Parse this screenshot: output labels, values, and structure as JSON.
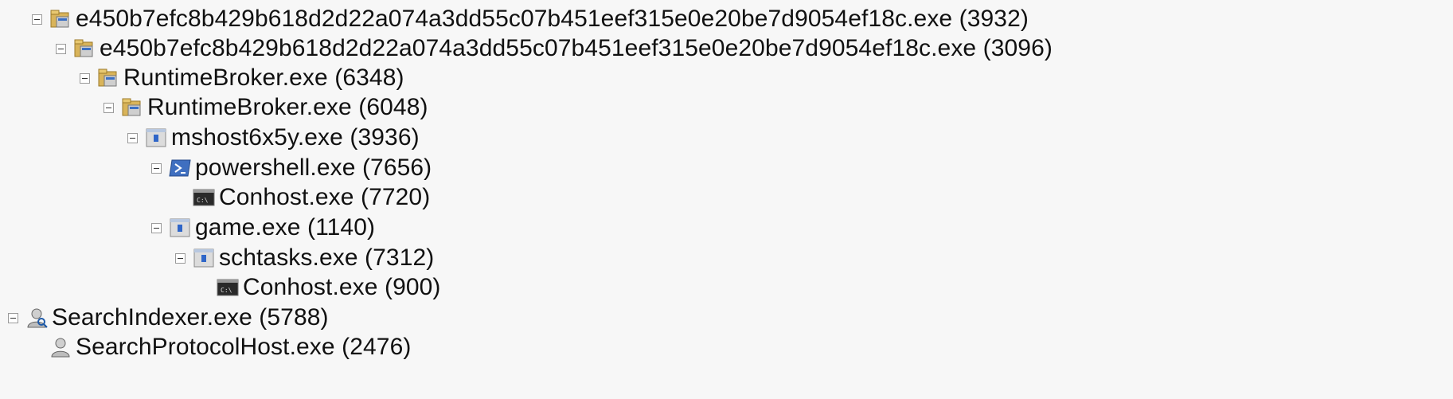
{
  "process_tree": {
    "rows": [
      {
        "label": "e450b7efc8b429b618d2d22a074a3dd55c07b451eef315e0e20be7d9054ef18c.exe (3932)",
        "icon": "folder-app-icon",
        "expanded": true
      },
      {
        "label": "e450b7efc8b429b618d2d22a074a3dd55c07b451eef315e0e20be7d9054ef18c.exe (3096)",
        "icon": "folder-app-icon",
        "expanded": true
      },
      {
        "label": "RuntimeBroker.exe (6348)",
        "icon": "folder-app-icon",
        "expanded": true
      },
      {
        "label": "RuntimeBroker.exe (6048)",
        "icon": "folder-app-icon",
        "expanded": true
      },
      {
        "label": "mshost6x5y.exe (3936)",
        "icon": "window-app-icon",
        "expanded": true
      },
      {
        "label": "powershell.exe (7656)",
        "icon": "powershell-icon",
        "expanded": true
      },
      {
        "label": "Conhost.exe (7720)",
        "icon": "console-icon",
        "expanded": false
      },
      {
        "label": "game.exe (1140)",
        "icon": "window-app-icon",
        "expanded": true
      },
      {
        "label": "schtasks.exe (7312)",
        "icon": "window-app-icon",
        "expanded": true
      },
      {
        "label": "Conhost.exe (900)",
        "icon": "console-icon",
        "expanded": false
      },
      {
        "label": "SearchIndexer.exe (5788)",
        "icon": "search-indexer-icon",
        "expanded": true
      },
      {
        "label": "SearchProtocolHost.exe (2476)",
        "icon": "search-protocol-icon",
        "expanded": false
      }
    ]
  }
}
